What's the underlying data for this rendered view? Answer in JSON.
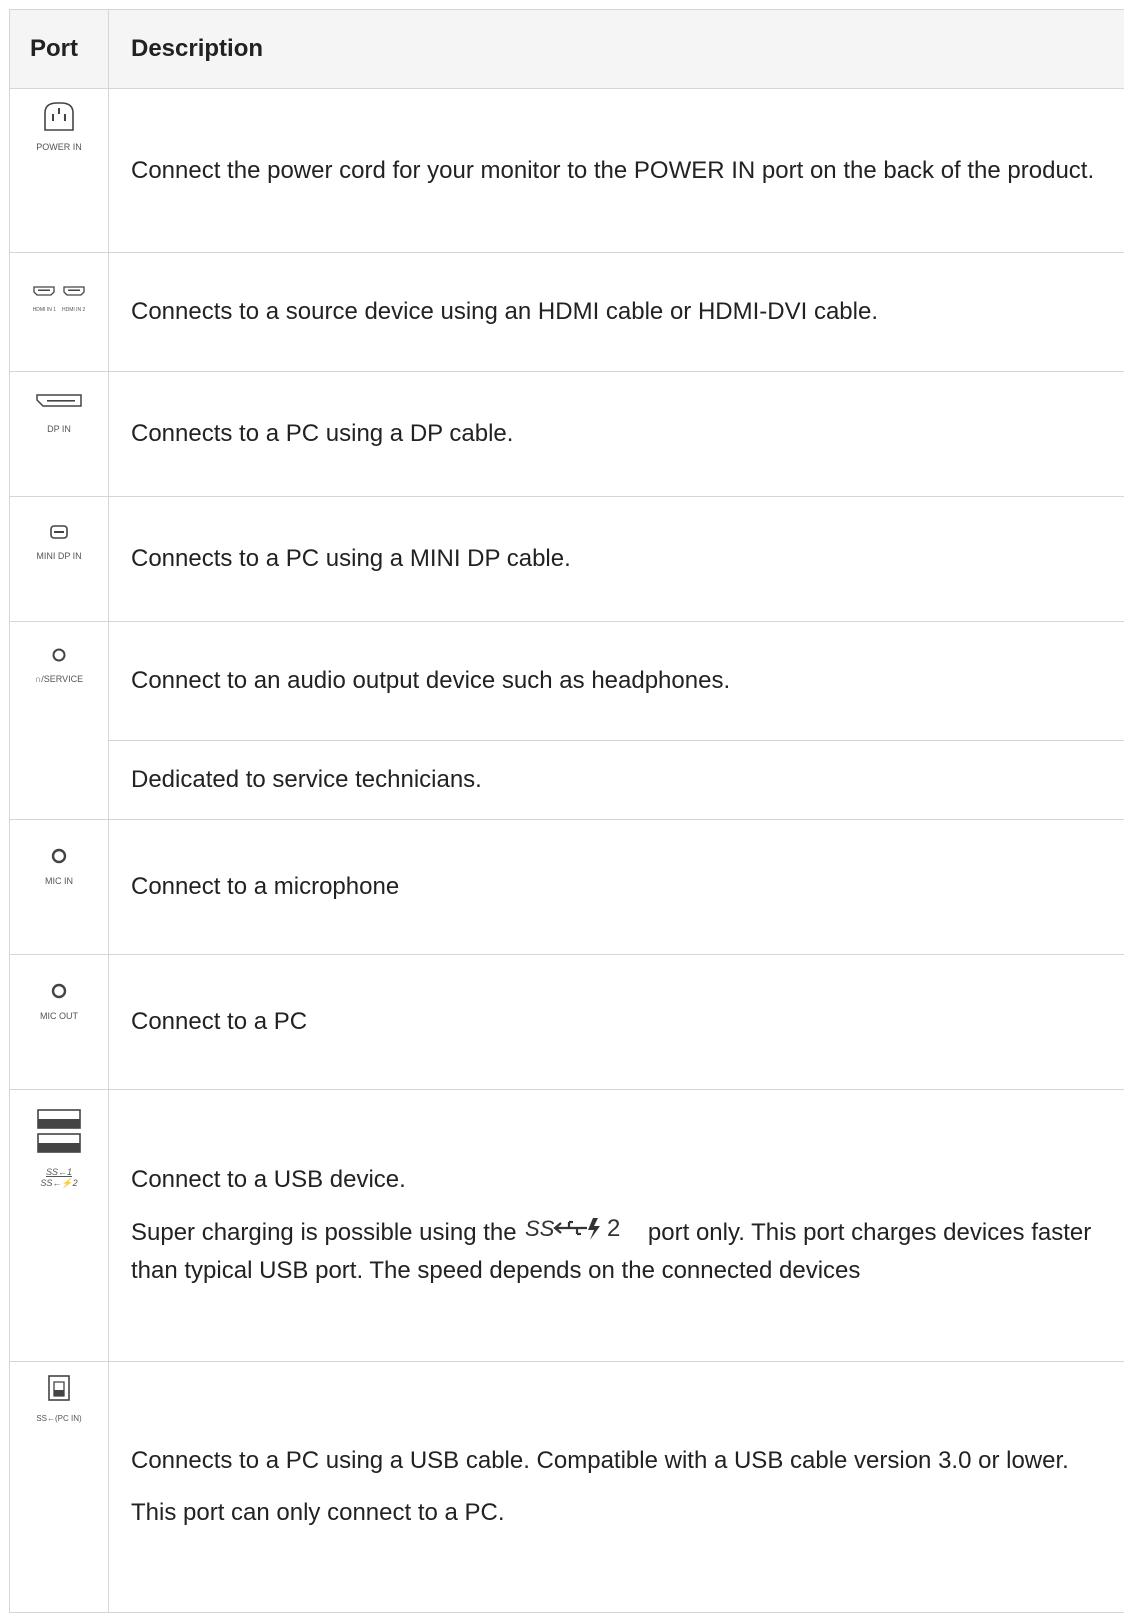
{
  "table": {
    "headers": {
      "port": "Port",
      "description": "Description"
    },
    "rows": [
      {
        "port_label": "POWER IN",
        "icon": "power-in-icon",
        "desc": [
          "Connect the power cord for your monitor to the POWER IN port on the back of the product."
        ]
      },
      {
        "port_label_1": "HDMI IN 1",
        "port_label_2": "HDMI IN 2",
        "icon": "hdmi-icon",
        "desc": [
          "Connects to a source device using an HDMI cable or HDMI-DVI cable."
        ]
      },
      {
        "port_label": "DP IN",
        "icon": "displayport-icon",
        "desc": [
          "Connects to a PC using a DP cable."
        ]
      },
      {
        "port_label": "MINI DP IN",
        "icon": "mini-displayport-icon",
        "desc": [
          "Connects to a PC using a MINI DP cable."
        ]
      },
      {
        "port_label": "∩/SERVICE",
        "icon": "headphone-jack-icon",
        "desc": [
          "Connect to an audio output device such as headphones.",
          "Dedicated to service technicians."
        ]
      },
      {
        "port_label": "MIC IN",
        "icon": "mic-in-jack-icon",
        "desc": [
          "Connect to a microphone"
        ]
      },
      {
        "port_label": "MIC OUT",
        "icon": "mic-out-jack-icon",
        "desc": [
          "Connect to a PC"
        ]
      },
      {
        "port_label_1": "SS←1",
        "port_label_2": "SS←⚡2",
        "icon": "usb-a-ports-icon",
        "desc_1": "Connect to a USB device.",
        "desc_2_pre": "Super charging is possible using the",
        "desc_2_icon_label": "SS←⚡2",
        "desc_2_post": "port only. This port charges devices faster than typical USB port. The speed depends on the connected devices"
      },
      {
        "port_label": "SS←(PC IN)",
        "icon": "usb-b-port-icon",
        "desc": [
          "Connects to a PC using a USB cable. Compatible with a USB cable version 3.0 or lower.",
          "This port can only connect to a PC."
        ]
      }
    ]
  }
}
